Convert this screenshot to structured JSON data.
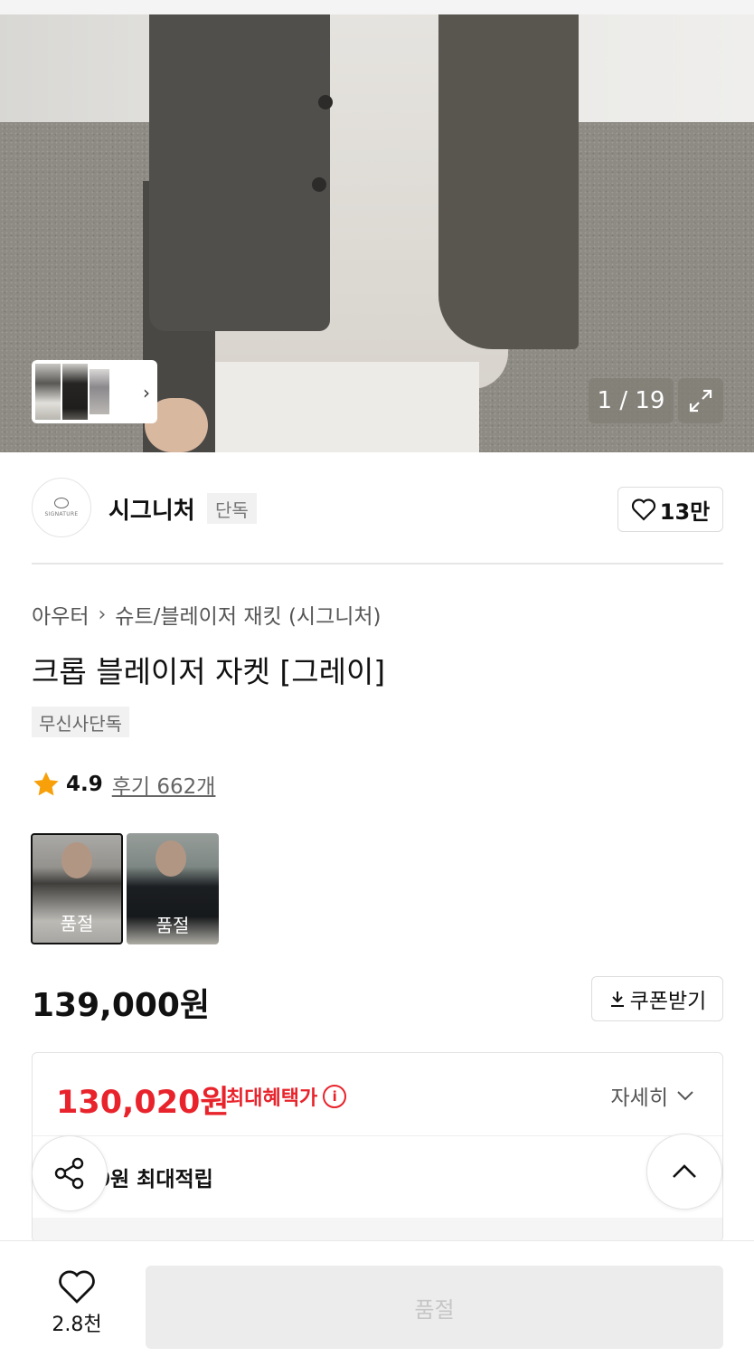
{
  "gallery": {
    "counter": "1 / 19"
  },
  "brand": {
    "logo_text": "SIGNATURE",
    "name": "시그니처",
    "tag": "단독",
    "likes": "13만"
  },
  "breadcrumb": {
    "category": "아우터",
    "subcategory": "슈트/블레이저 재킷 (시그니처)"
  },
  "product": {
    "title": "크롭 블레이저 자켓 [그레이]",
    "badge": "무신사단독",
    "rating": "4.9",
    "reviews": "후기 662개",
    "price": "139,000원"
  },
  "options": [
    {
      "label": "품절"
    },
    {
      "label": "품절"
    }
  ],
  "coupon": {
    "label": "쿠폰받기"
  },
  "benefit": {
    "sale_price": "130,020원",
    "sale_label": "최대혜택가",
    "detail_label": "자세히",
    "points_text": "0원 최대적립"
  },
  "bottom_bar": {
    "wish_count": "2.8천",
    "soldout_label": "품절"
  },
  "colors": {
    "accent_red": "#e8232b",
    "star": "#f7a00a"
  }
}
